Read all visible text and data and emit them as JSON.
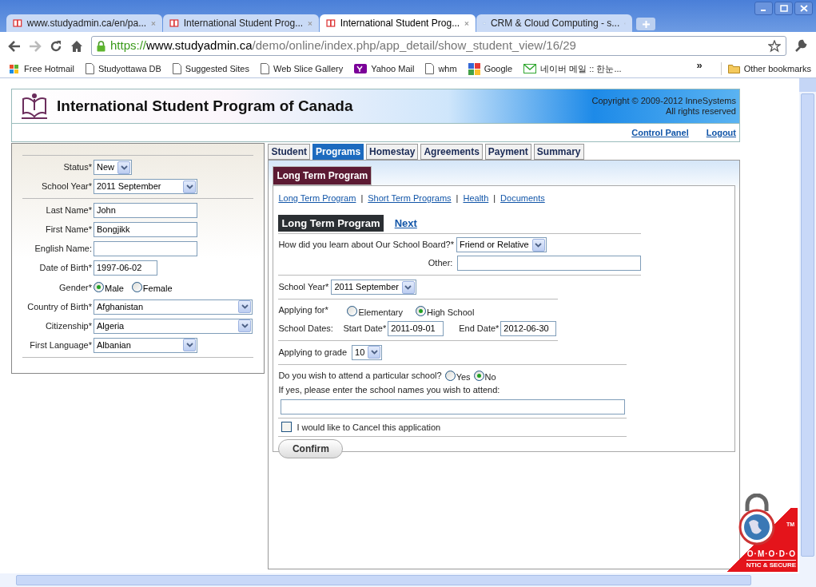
{
  "browser": {
    "tabs": [
      {
        "title": "www.studyadmin.ca/en/pa...",
        "selected": false
      },
      {
        "title": "International Student Prog...",
        "selected": false
      },
      {
        "title": "International Student Prog...",
        "selected": true
      },
      {
        "title": "CRM & Cloud Computing - s...",
        "selected": false
      }
    ],
    "url": {
      "scheme": "https://",
      "host": "www.studyadmin.ca",
      "path": "/demo/online/index.php/app_detail/show_student_view/16/29"
    },
    "bookmarks": [
      {
        "label": "Free Hotmail"
      },
      {
        "label": "Studyottawa DB"
      },
      {
        "label": "Suggested Sites"
      },
      {
        "label": "Web Slice Gallery"
      },
      {
        "label": "Yahoo Mail"
      },
      {
        "label": "whm"
      },
      {
        "label": "Google"
      },
      {
        "label": "네이버 메일 :: 한눈..."
      }
    ],
    "more": "»",
    "other_bookmarks": "Other bookmarks"
  },
  "header": {
    "title": "International Student Program of Canada",
    "copyright": "Copyright © 2009-2012 InneSystems",
    "rights": "All rights reserved",
    "links": [
      "Control Panel",
      "Logout"
    ]
  },
  "student_form": {
    "groups": [
      [
        {
          "label": "Status*",
          "kind": "select",
          "value": "New"
        },
        {
          "label": "School Year*",
          "kind": "select",
          "value": "2011 September"
        }
      ],
      [
        {
          "label": "Last Name*",
          "kind": "text",
          "value": "John"
        },
        {
          "label": "First Name*",
          "kind": "text",
          "value": "Bongjikk"
        },
        {
          "label": "English Name:",
          "kind": "text"
        },
        {
          "label": "Date of Birth*",
          "kind": "text",
          "value": "1997-06-02"
        },
        {
          "label": "Gender*",
          "kind": "radio",
          "options": [
            {
              "label": "Male",
              "selected": true
            },
            {
              "label": "Female",
              "selected": false
            }
          ]
        },
        {
          "label": "Country of Birth*",
          "kind": "select",
          "value": "Afghanistan"
        },
        {
          "label": "Citizenship*",
          "kind": "select",
          "value": "Algeria"
        },
        {
          "label": "First Language*",
          "kind": "select",
          "value": "Albanian"
        }
      ]
    ]
  },
  "section_tabs": [
    {
      "label": "Student",
      "selected": false
    },
    {
      "label": "Programs",
      "selected": true
    },
    {
      "label": "Homestay",
      "selected": false
    },
    {
      "label": "Agreements",
      "selected": false
    },
    {
      "label": "Payment",
      "selected": false
    },
    {
      "label": "Summary",
      "selected": false
    }
  ],
  "program": {
    "tab": "Long Term Program",
    "links": [
      "Long Term Program",
      "Short Term Programs",
      "Health",
      "Documents"
    ],
    "separator": "|",
    "heading": "Long Term Program",
    "next": "Next",
    "learn": {
      "label": "How did you learn about Our School Board?*",
      "value": "Friend or Relative"
    },
    "other": {
      "label": "Other:"
    },
    "school_year": {
      "label": "School Year*",
      "value": "2011 September"
    },
    "applying_for": {
      "label": "Applying for*",
      "options": [
        {
          "label": "Elementary",
          "selected": false
        },
        {
          "label": "High School",
          "selected": true
        }
      ]
    },
    "dates": {
      "label": "School Dates:",
      "start_label": "Start Date*",
      "start": "2011-09-01",
      "end_label": "End Date*",
      "end": "2012-06-30"
    },
    "grade": {
      "label": "Applying to grade",
      "value": "10"
    },
    "particular": {
      "label": "Do you wish to attend a particular school?",
      "options": [
        {
          "label": "Yes",
          "selected": false
        },
        {
          "label": "No",
          "selected": true
        }
      ]
    },
    "names_label": "If yes, please enter the school names you wish to attend:",
    "cancel": {
      "label": "I would like to Cancel this application",
      "checked": false
    },
    "confirm": "Confirm"
  },
  "badge": {
    "brand": "O·M·O·D·O",
    "tagline": "NTIC & SECURE",
    "tm": "TM"
  }
}
